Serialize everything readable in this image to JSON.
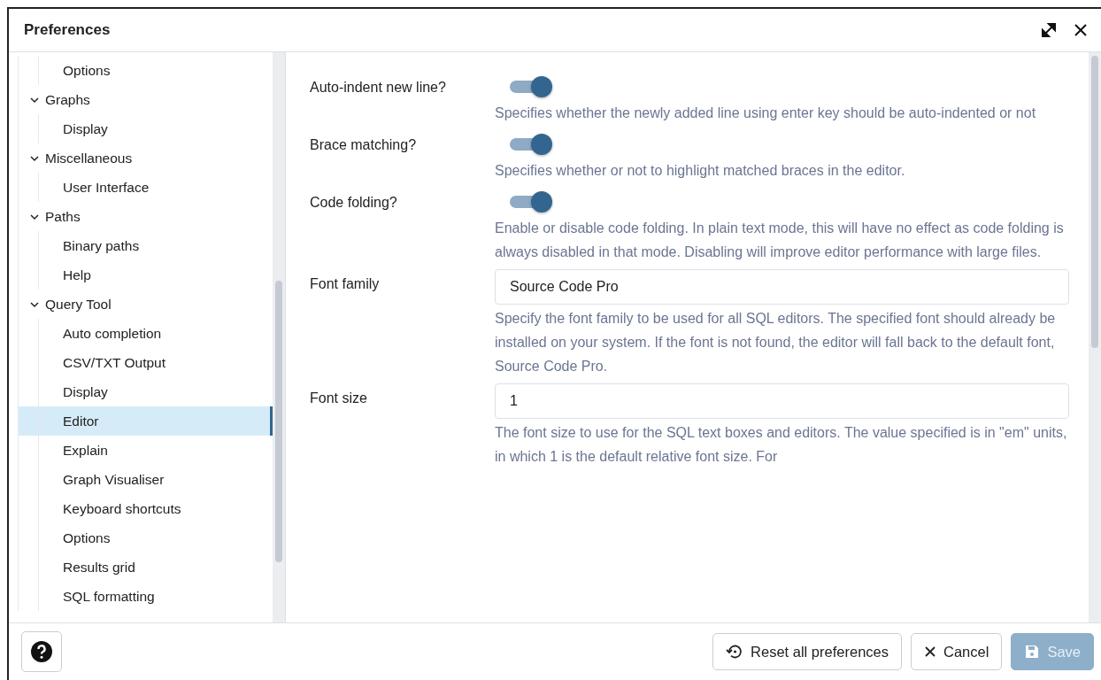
{
  "window": {
    "title": "Preferences"
  },
  "sidebar": {
    "groups": [
      {
        "children": [
          {
            "label": "Options",
            "selected": false
          }
        ]
      },
      {
        "label": "Graphs",
        "expanded": true,
        "children": [
          {
            "label": "Display",
            "selected": false
          }
        ]
      },
      {
        "label": "Miscellaneous",
        "expanded": true,
        "children": [
          {
            "label": "User Interface",
            "selected": false
          }
        ]
      },
      {
        "label": "Paths",
        "expanded": true,
        "children": [
          {
            "label": "Binary paths",
            "selected": false
          },
          {
            "label": "Help",
            "selected": false
          }
        ]
      },
      {
        "label": "Query Tool",
        "expanded": true,
        "children": [
          {
            "label": "Auto completion",
            "selected": false
          },
          {
            "label": "CSV/TXT Output",
            "selected": false
          },
          {
            "label": "Display",
            "selected": false
          },
          {
            "label": "Editor",
            "selected": true
          },
          {
            "label": "Explain",
            "selected": false
          },
          {
            "label": "Graph Visualiser",
            "selected": false
          },
          {
            "label": "Keyboard shortcuts",
            "selected": false
          },
          {
            "label": "Options",
            "selected": false
          },
          {
            "label": "Results grid",
            "selected": false
          },
          {
            "label": "SQL formatting",
            "selected": false
          }
        ]
      }
    ]
  },
  "settings": [
    {
      "kind": "toggle",
      "label": "Auto-indent new line?",
      "on": true,
      "description": "Specifies whether the newly added line using enter key should be auto-indented or not"
    },
    {
      "kind": "toggle",
      "label": "Brace matching?",
      "on": true,
      "description": "Specifies whether or not to highlight matched braces in the editor."
    },
    {
      "kind": "toggle",
      "label": "Code folding?",
      "on": true,
      "description": "Enable or disable code folding. In plain text mode, this will have no effect as code folding is always disabled in that mode. Disabling will improve editor performance with large files."
    },
    {
      "kind": "text",
      "label": "Font family",
      "value": "Source Code Pro",
      "description": "Specify the font family to be used for all SQL editors. The specified font should already be installed on your system. If the font is not found, the editor will fall back to the default font, Source Code Pro."
    },
    {
      "kind": "text",
      "label": "Font size",
      "value": "1",
      "description": "The font size to use for the SQL text boxes and editors. The value specified is in \"em\" units, in which 1 is the default relative font size. For"
    }
  ],
  "footer": {
    "reset": "Reset all preferences",
    "cancel": "Cancel",
    "save": {
      "label": "Save",
      "disabled": true
    }
  }
}
